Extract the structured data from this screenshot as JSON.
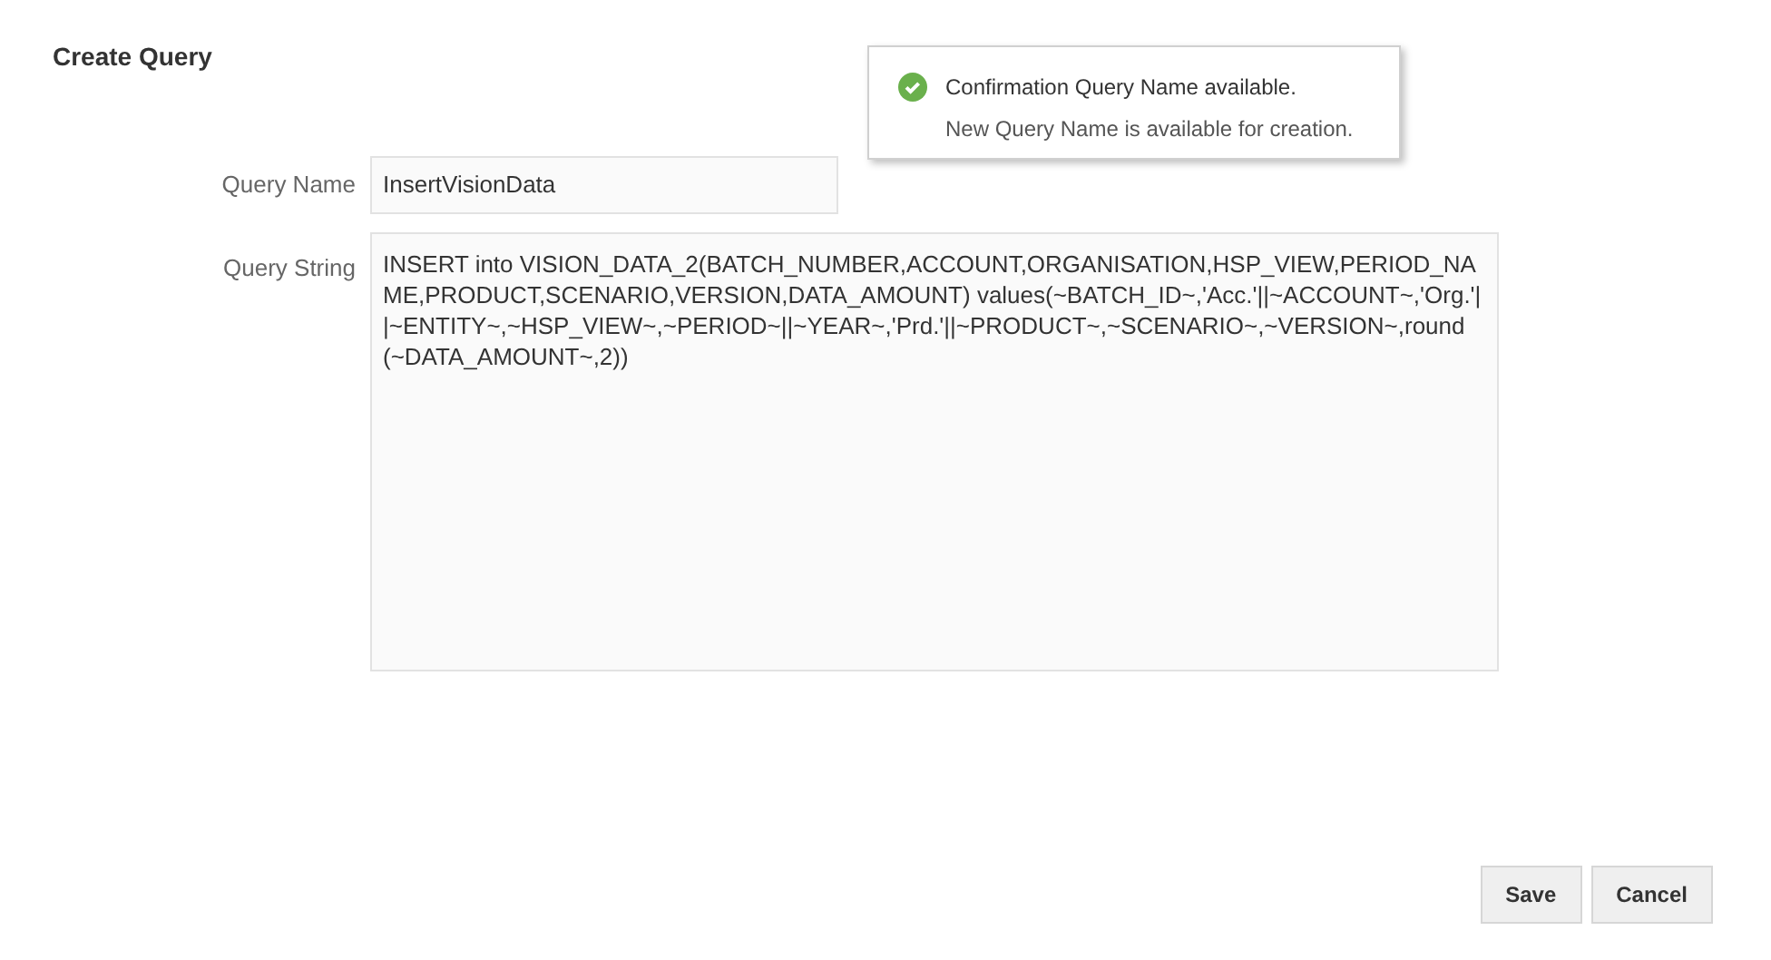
{
  "title": "Create Query",
  "notification": {
    "kind": "success",
    "title": "Confirmation Query Name available.",
    "message": "New Query Name is available for creation."
  },
  "fields": [
    {
      "label": "Query Name",
      "value": "InsertVisionData"
    },
    {
      "label": "Query String",
      "value": "INSERT into VISION_DATA_2(BATCH_NUMBER,ACCOUNT,ORGANISATION,HSP_VIEW,PERIOD_NAME,PRODUCT,SCENARIO,VERSION,DATA_AMOUNT) values(~BATCH_ID~,'Acc.'||~ACCOUNT~,'Org.'||~ENTITY~,~HSP_VIEW~,~PERIOD~||~YEAR~,'Prd.'||~PRODUCT~,~SCENARIO~,~VERSION~,round(~DATA_AMOUNT~,2))"
    }
  ],
  "buttons": [
    "Save",
    "Cancel"
  ]
}
